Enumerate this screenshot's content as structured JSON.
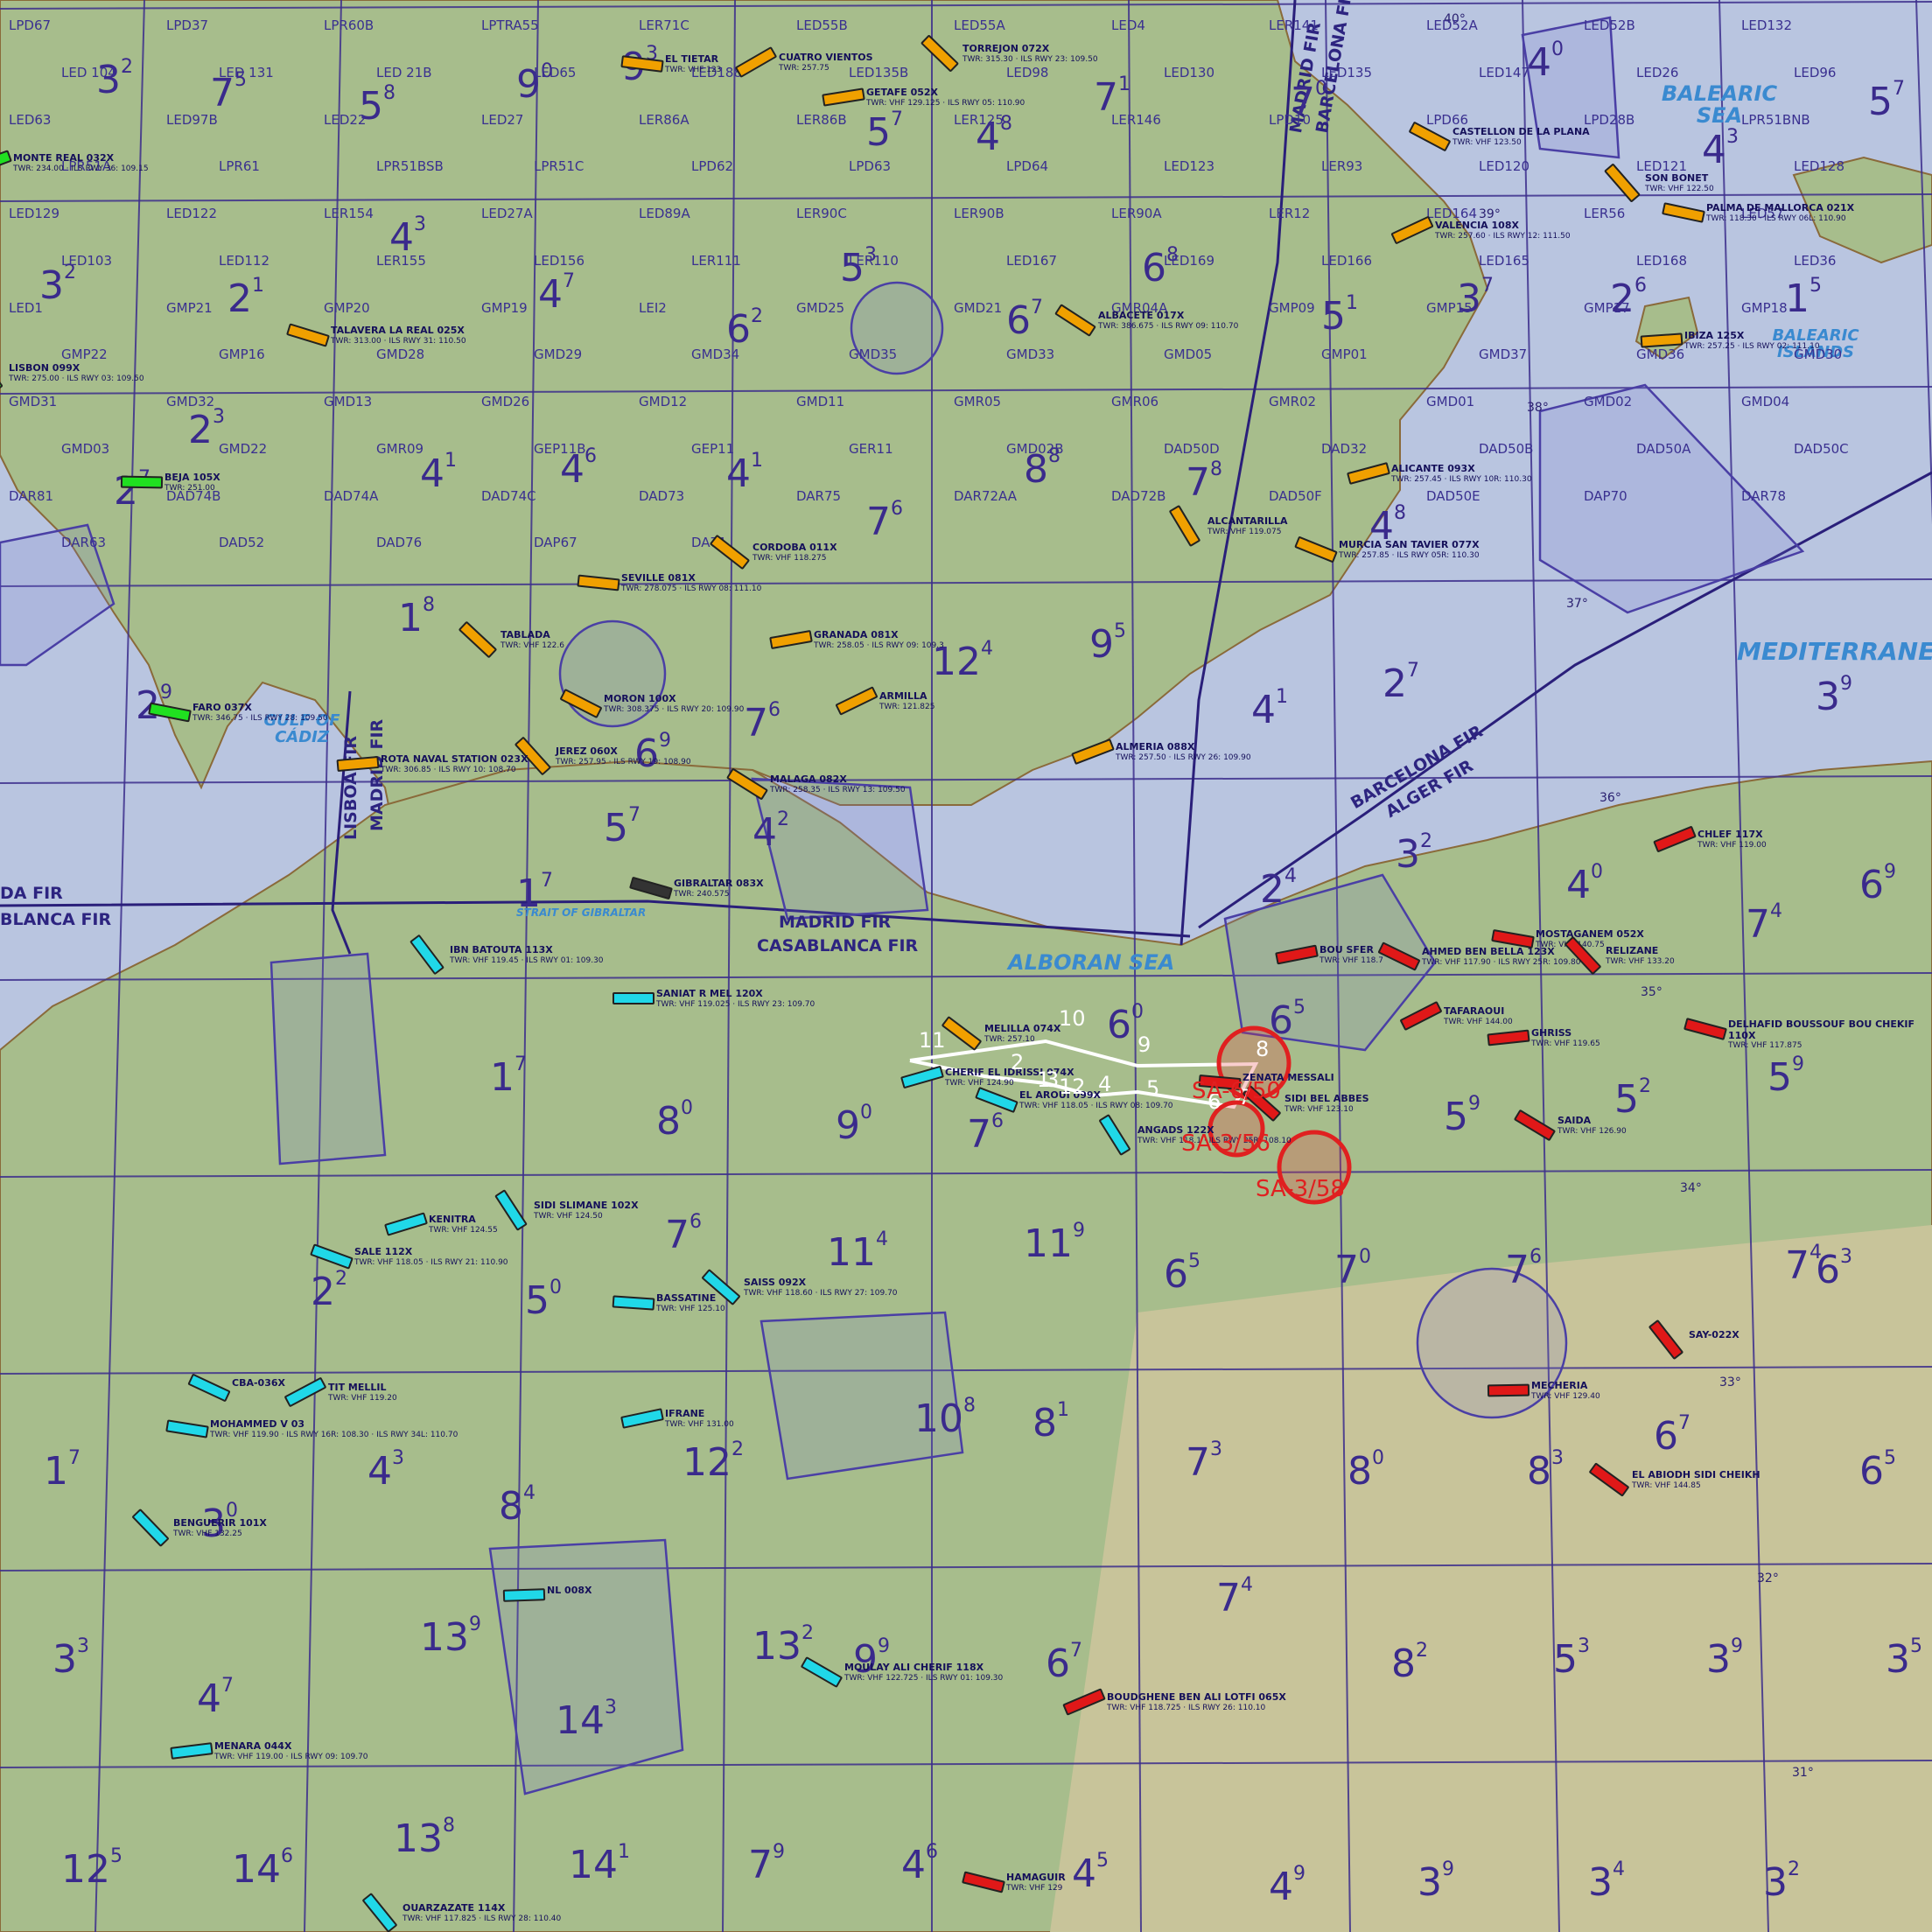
{
  "map": {
    "fir_labels": [
      "LISBOA FIR",
      "MADRID FIR",
      "MADRID FIR",
      "BARCELONA FIR",
      "MADRID FIR",
      "CASABLANCA FIR",
      "BARCELONA FIR",
      "ALGER FIR",
      "DA FIR",
      "BLANCA FIR"
    ],
    "sea_labels": [
      "BALEARIC SEA",
      "BALEARIC ISLANDS",
      "MEDITERRANE",
      "GULF OF CÁDIZ",
      "STRAIT OF GIBRALTAR",
      "ALBORAN SEA"
    ],
    "latitude_labels": [
      "40°",
      "39°",
      "38°",
      "37°",
      "36°",
      "35°",
      "34°",
      "33°",
      "32°",
      "31°"
    ],
    "sectors": [
      {
        "n": "3",
        "s": "2"
      },
      {
        "n": "7",
        "s": "5"
      },
      {
        "n": "5",
        "s": "8"
      },
      {
        "n": "9",
        "s": "0"
      },
      {
        "n": "9",
        "s": "3"
      },
      {
        "n": "5",
        "s": "7"
      },
      {
        "n": "4",
        "s": "8"
      },
      {
        "n": "7",
        "s": "1"
      },
      {
        "n": "7",
        "s": "0"
      },
      {
        "n": "4",
        "s": "0"
      },
      {
        "n": "5",
        "s": "7"
      },
      {
        "n": "4",
        "s": "3"
      },
      {
        "n": "3",
        "s": "2"
      },
      {
        "n": "2",
        "s": "1"
      },
      {
        "n": "4",
        "s": "3"
      },
      {
        "n": "4",
        "s": "7"
      },
      {
        "n": "5",
        "s": "3"
      },
      {
        "n": "6",
        "s": "8"
      },
      {
        "n": "6",
        "s": "2"
      },
      {
        "n": "6",
        "s": "7"
      },
      {
        "n": "5",
        "s": "1"
      },
      {
        "n": "3",
        "s": "7"
      },
      {
        "n": "2",
        "s": "6"
      },
      {
        "n": "1",
        "s": "5"
      },
      {
        "n": "2",
        "s": "3"
      },
      {
        "n": "2",
        "s": "7"
      },
      {
        "n": "4",
        "s": "1"
      },
      {
        "n": "4",
        "s": "6"
      },
      {
        "n": "4",
        "s": "1"
      },
      {
        "n": "8",
        "s": "8"
      },
      {
        "n": "7",
        "s": "8"
      },
      {
        "n": "7",
        "s": "6"
      },
      {
        "n": "4",
        "s": "8"
      },
      {
        "n": "1",
        "s": "8"
      },
      {
        "n": "12",
        "s": "4"
      },
      {
        "n": "9",
        "s": "5"
      },
      {
        "n": "2",
        "s": "9"
      },
      {
        "n": "6",
        "s": "9"
      },
      {
        "n": "7",
        "s": "6"
      },
      {
        "n": "4",
        "s": "1"
      },
      {
        "n": "2",
        "s": "7"
      },
      {
        "n": "3",
        "s": "9"
      },
      {
        "n": "5",
        "s": "7"
      },
      {
        "n": "4",
        "s": "2"
      },
      {
        "n": "1",
        "s": "7"
      },
      {
        "n": "2",
        "s": "4"
      },
      {
        "n": "3",
        "s": "2"
      },
      {
        "n": "4",
        "s": "0"
      },
      {
        "n": "6",
        "s": "9"
      },
      {
        "n": "7",
        "s": "4"
      },
      {
        "n": "1",
        "s": "7"
      },
      {
        "n": "8",
        "s": "0"
      },
      {
        "n": "9",
        "s": "0"
      },
      {
        "n": "7",
        "s": "6"
      },
      {
        "n": "6",
        "s": "0"
      },
      {
        "n": "6",
        "s": "5"
      },
      {
        "n": "5",
        "s": "9"
      },
      {
        "n": "5",
        "s": "2"
      },
      {
        "n": "5",
        "s": "9"
      },
      {
        "n": "2",
        "s": "2"
      },
      {
        "n": "5",
        "s": "0"
      },
      {
        "n": "7",
        "s": "6"
      },
      {
        "n": "11",
        "s": "4"
      },
      {
        "n": "11",
        "s": "9"
      },
      {
        "n": "6",
        "s": "5"
      },
      {
        "n": "7",
        "s": "0"
      },
      {
        "n": "7",
        "s": "6"
      },
      {
        "n": "7",
        "s": "4"
      },
      {
        "n": "6",
        "s": "3"
      },
      {
        "n": "1",
        "s": "7"
      },
      {
        "n": "4",
        "s": "3"
      },
      {
        "n": "3",
        "s": "0"
      },
      {
        "n": "8",
        "s": "4"
      },
      {
        "n": "12",
        "s": "2"
      },
      {
        "n": "10",
        "s": "8"
      },
      {
        "n": "8",
        "s": "1"
      },
      {
        "n": "7",
        "s": "3"
      },
      {
        "n": "8",
        "s": "0"
      },
      {
        "n": "8",
        "s": "3"
      },
      {
        "n": "6",
        "s": "7"
      },
      {
        "n": "6",
        "s": "5"
      },
      {
        "n": "3",
        "s": "3"
      },
      {
        "n": "4",
        "s": "7"
      },
      {
        "n": "13",
        "s": "9"
      },
      {
        "n": "14",
        "s": "3"
      },
      {
        "n": "13",
        "s": "2"
      },
      {
        "n": "9",
        "s": "9"
      },
      {
        "n": "6",
        "s": "7"
      },
      {
        "n": "7",
        "s": "4"
      },
      {
        "n": "8",
        "s": "2"
      },
      {
        "n": "5",
        "s": "3"
      },
      {
        "n": "3",
        "s": "9"
      },
      {
        "n": "3",
        "s": "5"
      },
      {
        "n": "12",
        "s": "5"
      },
      {
        "n": "14",
        "s": "6"
      },
      {
        "n": "13",
        "s": "8"
      },
      {
        "n": "14",
        "s": "1"
      },
      {
        "n": "7",
        "s": "9"
      },
      {
        "n": "4",
        "s": "6"
      },
      {
        "n": "4",
        "s": "5"
      },
      {
        "n": "4",
        "s": "9"
      },
      {
        "n": "3",
        "s": "9"
      },
      {
        "n": "3",
        "s": "4"
      },
      {
        "n": "3",
        "s": "2"
      }
    ],
    "area_codes": [
      "LPD67",
      "LPD37",
      "LPR60B",
      "LPTRA55",
      "LER71C",
      "LED55B",
      "LED55A",
      "LED4",
      "LER141",
      "LED52A",
      "LED52B",
      "LED132",
      "LED 104",
      "LED 131",
      "LED 21B",
      "LED65",
      "LED188",
      "LED135B",
      "LED98",
      "LED130",
      "LED135",
      "LED147",
      "LED26",
      "LED96",
      "LED63",
      "LED97B",
      "LED22",
      "LED27",
      "LER86A",
      "LER86B",
      "LER125",
      "LER146",
      "LPD10",
      "LPD66",
      "LPD28B",
      "LPR51BNB",
      "LPR51A",
      "LPR61",
      "LPR51BSB",
      "LPR51C",
      "LPD62",
      "LPD63",
      "LPD64",
      "LED123",
      "LER93",
      "LED120",
      "LED121",
      "LED128",
      "LED129",
      "LED122",
      "LER154",
      "LED27A",
      "LED89A",
      "LER90C",
      "LER90B",
      "LER90A",
      "LER12",
      "LED164",
      "LER56",
      "LED57",
      "LED103",
      "LED112",
      "LER155",
      "LED156",
      "LER111",
      "LER110",
      "LED167",
      "LED169",
      "LED166",
      "LED165",
      "LED168",
      "LED36",
      "LED1",
      "GMP21",
      "GMP20",
      "GMP19",
      "LEI2",
      "GMD25",
      "GMD21",
      "GMR04A",
      "GMP09",
      "GMP15",
      "GMP17",
      "GMP18",
      "GMP22",
      "GMP16",
      "GMD28",
      "GMD29",
      "GMD34",
      "GMD35",
      "GMD33",
      "GMD05",
      "GMP01",
      "GMD37",
      "GMD36",
      "GMD30",
      "GMD31",
      "GMD32",
      "GMD13",
      "GMD26",
      "GMD12",
      "GMD11",
      "GMR05",
      "GMR06",
      "GMR02",
      "GMD01",
      "GMD02",
      "GMD04",
      "GMD03",
      "GMD22",
      "GMR09",
      "GEP11B",
      "GEP11",
      "GER11",
      "GMD02B",
      "DAD50D",
      "DAD32",
      "DAD50B",
      "DAD50A",
      "DAD50C",
      "DAR81",
      "DAD74B",
      "DAD74A",
      "DAD74C",
      "DAD73",
      "DAR75",
      "DAR72AA",
      "DAD72B",
      "DAD50F",
      "DAD50E",
      "DAP70",
      "DAR78",
      "DAR63",
      "DAD52",
      "DAD76",
      "DAP67",
      "DA71"
    ],
    "airports": [
      {
        "name": "CUATRO VIENTOS",
        "info": "TWR: 257.75"
      },
      {
        "name": "EL TIETAR",
        "info": "TWR: VHF 123"
      },
      {
        "name": "TORREJON 072X",
        "info": "TWR: 315.30 · ILS RWY 23: 109.50"
      },
      {
        "name": "GETAFE 052X",
        "info": "TWR: VHF 129.125 · ILS RWY 05: 110.90"
      },
      {
        "name": "CASTELLON DE LA PLANA",
        "info": "TWR: VHF 123.50"
      },
      {
        "name": "VALENCIA 108X",
        "info": "TWR: 257.60 · ILS RWY 12: 111.50"
      },
      {
        "name": "PALMA DE MALLORCA 021X",
        "info": "TWR: 118.30 · ILS RWY 06L: 110.90"
      },
      {
        "name": "SON BONET",
        "info": "TWR: VHF 122.50"
      },
      {
        "name": "IBIZA 125X",
        "info": "TWR: 257.25 · ILS RWY 02: 111.10"
      },
      {
        "name": "ALBACETE 017X",
        "info": "TWR: 386.675 · ILS RWY 09: 110.70"
      },
      {
        "name": "MONTE REAL 032X",
        "info": "TWR: 234.00 · ILS RWY 36: 109.15"
      },
      {
        "name": "TALAVERA LA REAL 025X",
        "info": "TWR: 313.00 · ILS RWY 31: 110.50"
      },
      {
        "name": "LISBON 099X",
        "info": "TWR: 275.00 · ILS RWY 03: 109.50"
      },
      {
        "name": "BEJA 105X",
        "info": "TWR: 251.00"
      },
      {
        "name": "CORDOBA 011X",
        "info": "TWR: VHF 118.275"
      },
      {
        "name": "ALICANTE 093X",
        "info": "TWR: 257.45 · ILS RWY 10R: 110.30"
      },
      {
        "name": "MURCIA SAN TAVIER 077X",
        "info": "TWR: 257.85 · ILS RWY 05R: 110.30"
      },
      {
        "name": "ALCANTARILLA",
        "info": "TWR: VHF 119.075"
      },
      {
        "name": "SEVILLE 081X",
        "info": "TWR: 278.075 · ILS RWY 08: 111.10"
      },
      {
        "name": "TABLADA",
        "info": "TWR: VHF 122.6"
      },
      {
        "name": "GRANADA 081X",
        "info": "TWR: 258.05 · ILS RWY 09: 109.3"
      },
      {
        "name": "MORON 100X",
        "info": "TWR: 308.375 · ILS RWY 20: 109.90"
      },
      {
        "name": "ARMILLA",
        "info": "TWR: 121.825"
      },
      {
        "name": "FARO 037X",
        "info": "TWR: 346.75 · ILS RWY 28: 109.50"
      },
      {
        "name": "JEREZ 060X",
        "info": "TWR: 257.95 · ILS RWY 19: 108.90"
      },
      {
        "name": "ROTA NAVAL STATION 023X",
        "info": "TWR: 306.85 · ILS RWY 10: 108.70"
      },
      {
        "name": "MALAGA 082X",
        "info": "TWR: 258.35 · ILS RWY 13: 109.50"
      },
      {
        "name": "ALMERIA 088X",
        "info": "TWR: 257.50 · ILS RWY 26: 109.90"
      },
      {
        "name": "GIBRALTAR 083X",
        "info": "TWR: 240.575"
      },
      {
        "name": "IBN BATOUTA 113X",
        "info": "TWR: VHF 119.45 · ILS RWY 01: 109.30"
      },
      {
        "name": "SANIAT R MEL 120X",
        "info": "TWR: VHF 119.025 · ILS RWY 23: 109.70"
      },
      {
        "name": "MELILLA 074X",
        "info": "TWR: 257.10"
      },
      {
        "name": "CHERIF EL IDRISSI 074X",
        "info": "TWR: VHF 124.90"
      },
      {
        "name": "EL AROUI 099X",
        "info": "TWR: VHF 118.05 · ILS RWY 08: 109.70"
      },
      {
        "name": "ANGADS 122X",
        "info": "TWR: VHF 118.1 · ILS RWY 25R: 108.10"
      },
      {
        "name": "ZENATA MESSALI",
        "info": ""
      },
      {
        "name": "SIDI BEL ABBES",
        "info": "TWR: VHF 123.10"
      },
      {
        "name": "BOU SFER",
        "info": "TWR: VHF 118.7"
      },
      {
        "name": "AHMED BEN BELLA 123X",
        "info": "TWR: VHF 117.90 · ILS RWY 25R: 109.80"
      },
      {
        "name": "TAFARAOUI",
        "info": "TWR: VHF 144.00"
      },
      {
        "name": "MOSTAGANEM 052X",
        "info": "TWR: VHF 140.75"
      },
      {
        "name": "RELIZANE",
        "info": "TWR: VHF 133.20"
      },
      {
        "name": "GHRISS",
        "info": "TWR: VHF 119.65"
      },
      {
        "name": "SAIDA",
        "info": "TWR: VHF 126.90"
      },
      {
        "name": "CHLEF 117X",
        "info": "TWR: VHF 119.00"
      },
      {
        "name": "DELHAFID BOUSSOUF BOU CHEKIF 110X",
        "info": "TWR: VHF 117.875"
      },
      {
        "name": "SAY-022X",
        "info": ""
      },
      {
        "name": "MECHERIA",
        "info": "TWR: VHF 129.40"
      },
      {
        "name": "EL ABIODH SIDI CHEIKH",
        "info": "TWR: VHF 144.85"
      },
      {
        "name": "KENITRA",
        "info": "TWR: VHF 124.55"
      },
      {
        "name": "SALE 112X",
        "info": "TWR: VHF 118.05 · ILS RWY 21: 110.90"
      },
      {
        "name": "SIDI SLIMANE 102X",
        "info": "TWR: VHF 124.50"
      },
      {
        "name": "BASSATINE",
        "info": "TWR: VHF 125.10"
      },
      {
        "name": "SAISS 092X",
        "info": "TWR: VHF 118.60 · ILS RWY 27: 109.70"
      },
      {
        "name": "IFRANE",
        "info": "TWR: VHF 131.00"
      },
      {
        "name": "CBA-036X",
        "info": ""
      },
      {
        "name": "TIT MELLIL",
        "info": "TWR: VHF 119.20"
      },
      {
        "name": "MOHAMMED V 03",
        "info": "TWR: VHF 119.90 · ILS RWY 16R: 108.30 · ILS RWY 34L: 110.70"
      },
      {
        "name": "BENGUERIR 101X",
        "info": "TWR: VHF 132.25"
      },
      {
        "name": "MENARA 044X",
        "info": "TWR: VHF 119.00 · ILS RWY 09: 109.70"
      },
      {
        "name": "MOULAY ALI CHERIF 118X",
        "info": "TWR: VHF 122.725 · ILS RWY 01: 109.30"
      },
      {
        "name": "BOUDGHENE BEN ALI LOTFI 065X",
        "info": "TWR: VHF 118.725 · ILS RWY 26: 110.10"
      },
      {
        "name": "HAMAGUIR",
        "info": "TWR: VHF 129"
      },
      {
        "name": "OUARZAZATE 114X",
        "info": "TWR: VHF 117.825 · ILS RWY 28: 110.40"
      },
      {
        "name": "NL 008X",
        "info": ""
      }
    ],
    "waypoints": [
      "10",
      "9",
      "8",
      "7",
      "6",
      "5",
      "4",
      "3",
      "2",
      "1",
      "11",
      "12"
    ],
    "threats": [
      "SA-6/50",
      "SA-3/56",
      "SA-3/58"
    ]
  }
}
